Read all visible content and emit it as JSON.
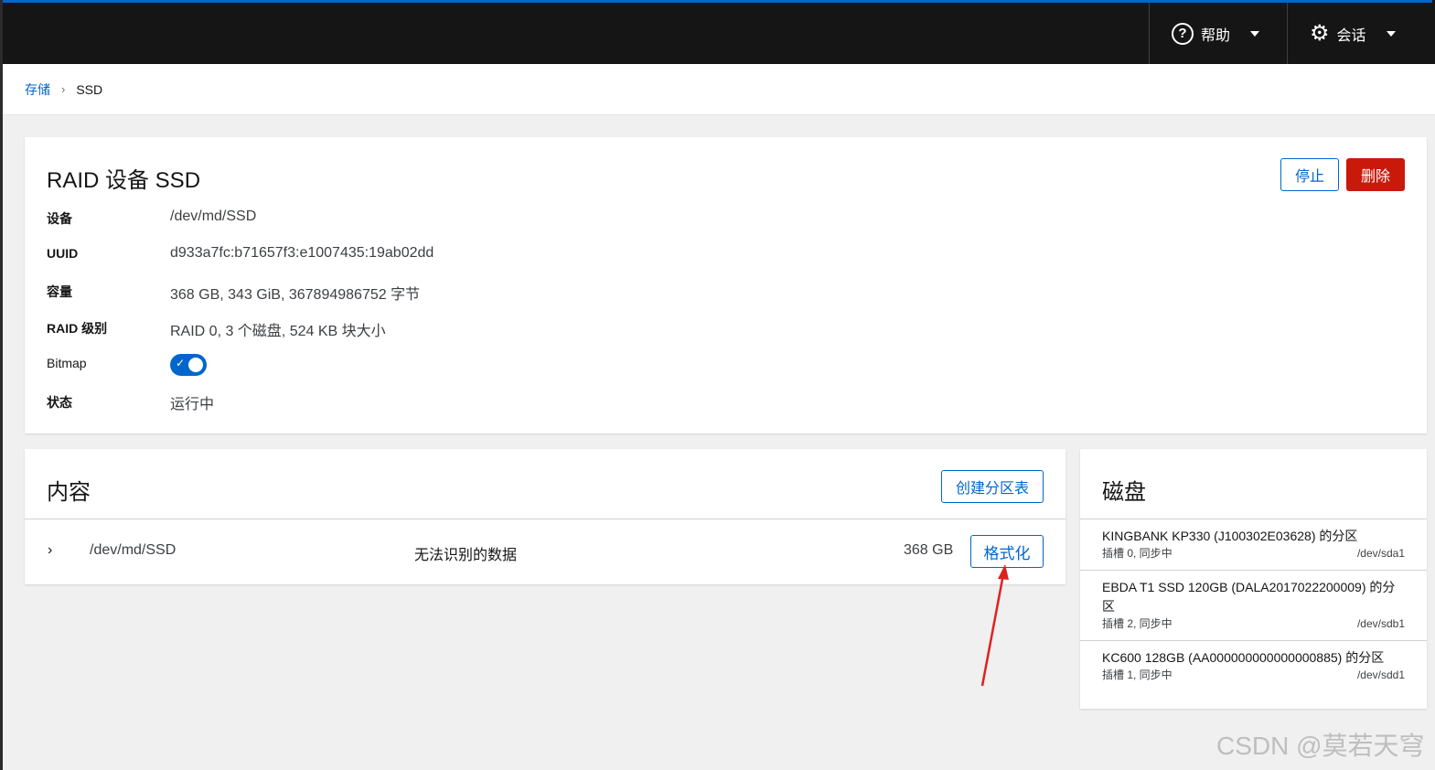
{
  "topbar": {
    "help_label": "帮助",
    "session_label": "会话",
    "accent_color": "#0066cc"
  },
  "breadcrumb": {
    "parent": "存储",
    "current": "SSD"
  },
  "raid": {
    "title": "RAID 设备 SSD",
    "stop_label": "停止",
    "delete_label": "删除",
    "fields": [
      {
        "label": "设备",
        "value": "/dev/md/SSD"
      },
      {
        "label": "UUID",
        "value": "d933a7fc:b71657f3:e1007435:19ab02dd"
      },
      {
        "label": "容量",
        "value": "368 GB, 343 GiB, 367894986752 字节"
      },
      {
        "label": "RAID 级别",
        "value": "RAID 0, 3 个磁盘, 524 KB 块大小"
      },
      {
        "label": "Bitmap",
        "value": ""
      },
      {
        "label": "状态",
        "value": "运行中"
      }
    ],
    "bitmap_enabled": true
  },
  "content": {
    "title": "内容",
    "create_label": "创建分区表",
    "row": {
      "path": "/dev/md/SSD",
      "description": "无法识别的数据",
      "size": "368 GB",
      "format_label": "格式化"
    }
  },
  "disks": {
    "title": "磁盘",
    "items": [
      {
        "name": "KINGBANK KP330 (J100302E03628) 的分区",
        "slot": "插槽 0, 同步中",
        "device": "/dev/sda1"
      },
      {
        "name": "EBDA T1 SSD 120GB (DALA2017022200009) 的分区",
        "slot": "插槽 2, 同步中",
        "device": "/dev/sdb1"
      },
      {
        "name": "KC600 128GB (AA000000000000000885) 的分区",
        "slot": "插槽 1, 同步中",
        "device": "/dev/sdd1"
      }
    ]
  },
  "watermark": "CSDN @莫若天穹"
}
